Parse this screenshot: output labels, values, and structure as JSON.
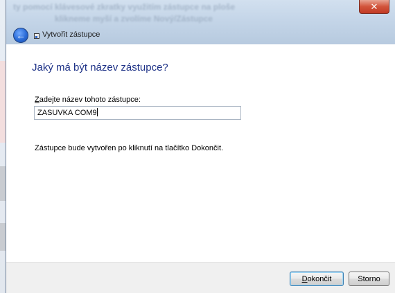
{
  "background_window": {
    "blurred_title_line1": "ty pomocí klávesové zkratky využitím zástupce na ploše",
    "blurred_title_line2": "klikneme myší a zvolíme Nový/Zástupce"
  },
  "titlebar": {
    "close_glyph": "✕",
    "back_glyph": "←",
    "wizard_title": "Vytvořit zástupce"
  },
  "content": {
    "heading": "Jaký má být název zástupce?",
    "label_underlined_char": "Z",
    "label_rest": "adejte název tohoto zástupce:",
    "input_value": "ZASUVKA COM9",
    "info_text": "Zástupce bude vytvořen po kliknutí na tlačítko Dokončit."
  },
  "buttons": {
    "finish_underlined_char": "D",
    "finish_rest": "okončit",
    "cancel": "Storno"
  }
}
